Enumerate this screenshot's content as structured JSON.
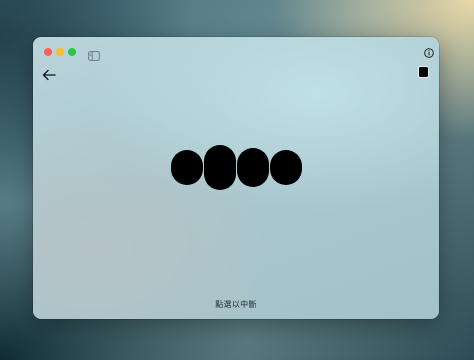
{
  "window": {
    "controls": {
      "close": "close-icon",
      "minimize": "minimize-icon",
      "maximize": "maximize-icon"
    },
    "toolbar": {
      "sidebar_icon": "sidebar-toggle-icon",
      "info_icon": "info-icon",
      "back_icon": "arrow-left-icon",
      "stop_icon": "stop-icon"
    }
  },
  "voice_indicator": {
    "bar_count": 4,
    "color": "#000000"
  },
  "hint": {
    "text": "點選以中斷"
  },
  "colors": {
    "close": "#ff5f57",
    "minimize": "#febc2e",
    "maximize": "#28c840"
  }
}
